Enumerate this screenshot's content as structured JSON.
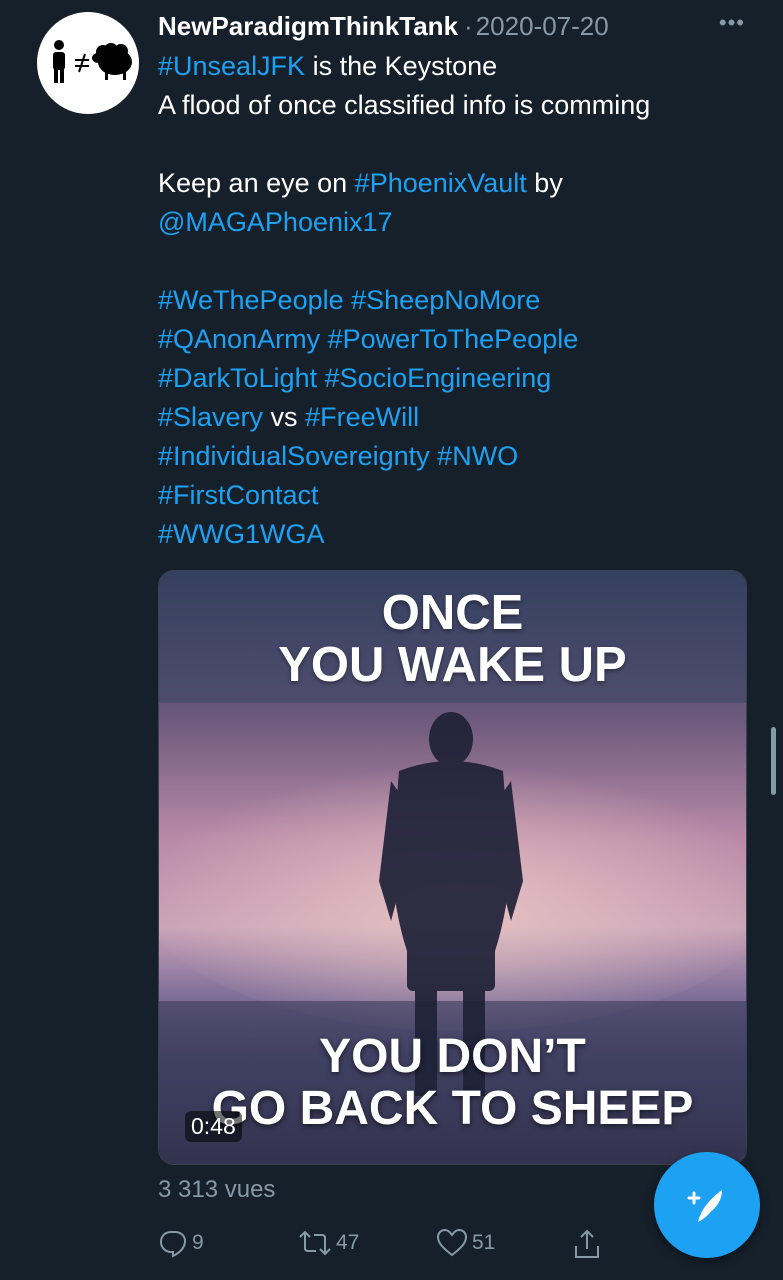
{
  "tweet": {
    "author": "NewParadigmThinkTank",
    "separator": "·",
    "date": "2020-07-20",
    "more_label": "•••",
    "line1_tag": "#UnsealJFK",
    "line1_rest": " is the Keystone",
    "line2": "A flood of once classified info is comming",
    "line3_pre": "Keep an eye on ",
    "line3_tag": "#PhoenixVault",
    "line3_post": " by",
    "line4_mention": "@MAGAPhoenix17",
    "line5": "#WeThePeople #SheepNoMore",
    "line6": "#QAnonArmy #PowerToThePeople",
    "line7": "#DarkToLight #SocioEngineering",
    "line8_tag1": "#Slavery",
    "line8_mid": " vs ",
    "line8_tag2": "#FreeWill",
    "line9": "#IndividualSovereignty #NWO",
    "line10": "#FirstContact",
    "line11": "#WWG1WGA"
  },
  "media": {
    "top_line1": "ONCE",
    "top_line2": "YOU WAKE UP",
    "bottom_line1": "YOU DON’T",
    "bottom_line2": "GO BACK TO SHEEP",
    "duration": "0:48"
  },
  "stats": {
    "views": "3 313 vues",
    "replies": "9",
    "retweets": "47",
    "likes": "51"
  },
  "icons": {
    "avatar": "person-not-equal-sheep-icon",
    "reply": "reply-icon",
    "retweet": "retweet-icon",
    "like": "heart-icon",
    "share": "share-icon",
    "compose": "compose-tweet-icon"
  },
  "colors": {
    "background": "#15202b",
    "link": "#1da1f2",
    "muted": "#8899a6",
    "fab": "#1da1f2"
  }
}
